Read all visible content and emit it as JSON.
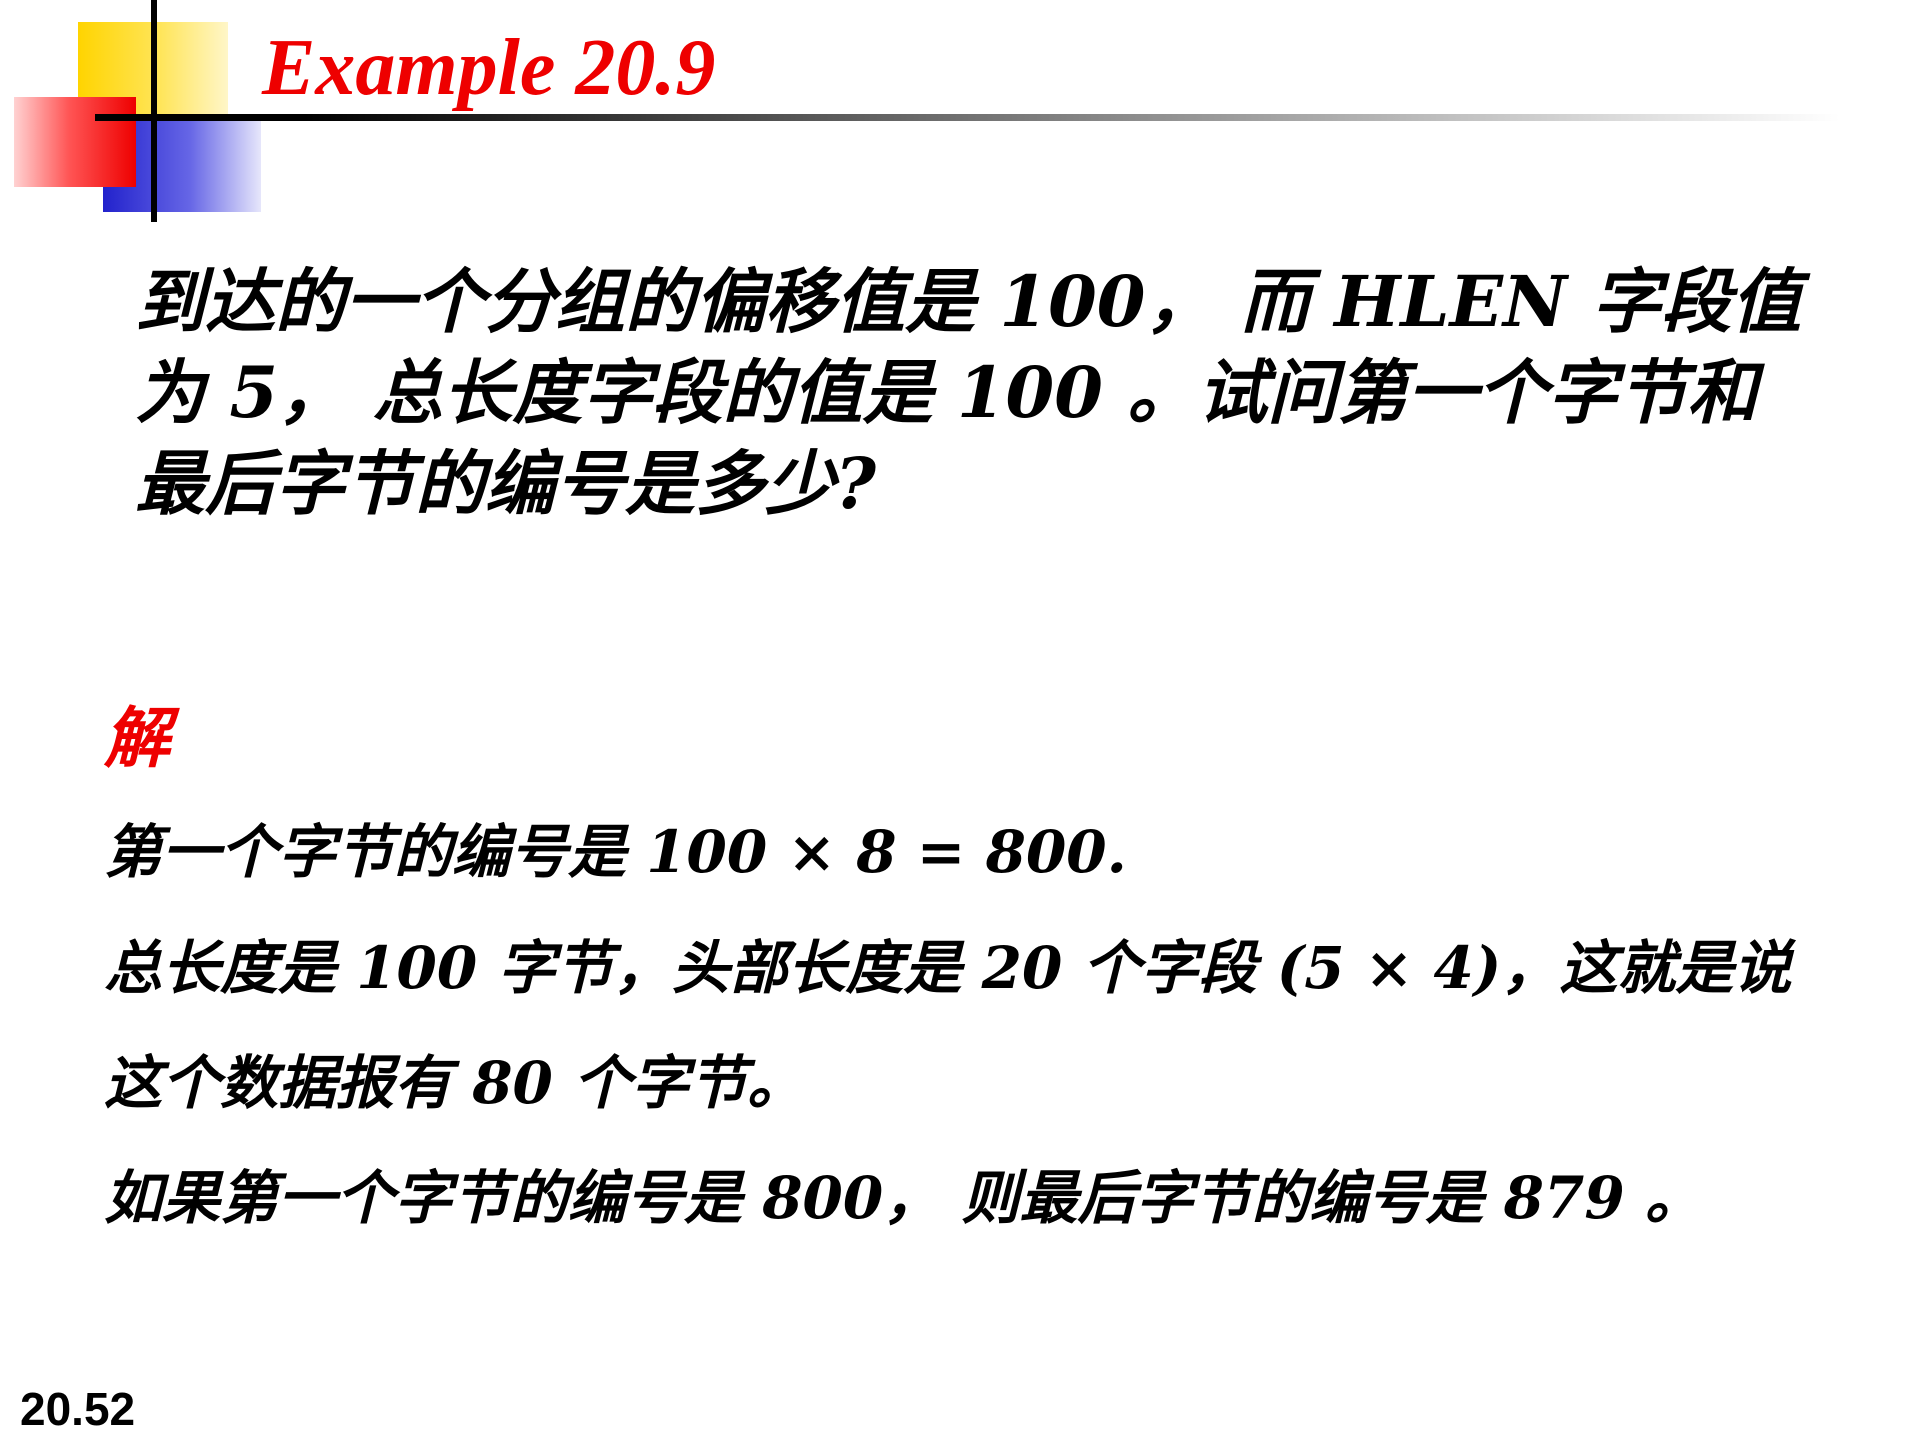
{
  "title": "Example 20.9",
  "question": {
    "lines": [
      "到达的一个分组的偏移值是 100， 而 HLEN 字段值",
      "为 5， 总长度字段的值是 100 。试问第一个字节和",
      "最后字节的编号是多少?"
    ]
  },
  "solution": {
    "label": "解",
    "lines": [
      "第一个字节的编号是 100 × 8 = 800.",
      "总长度是 100 字节，头部长度是  20  个字段 (5 × 4)，这就是说",
      "这个数据报有 80 个字节。",
      "如果第一个字节的编号是 800， 则最后字节的编号是 879 。"
    ]
  },
  "footer": {
    "page_number": "20.52"
  },
  "colors": {
    "title": "#ee0000",
    "solution_label": "#ee0000",
    "body_text": "#000000",
    "logo_yellow": "#ffd400",
    "logo_blue": "#2222cc",
    "logo_red": "#ee0000"
  }
}
